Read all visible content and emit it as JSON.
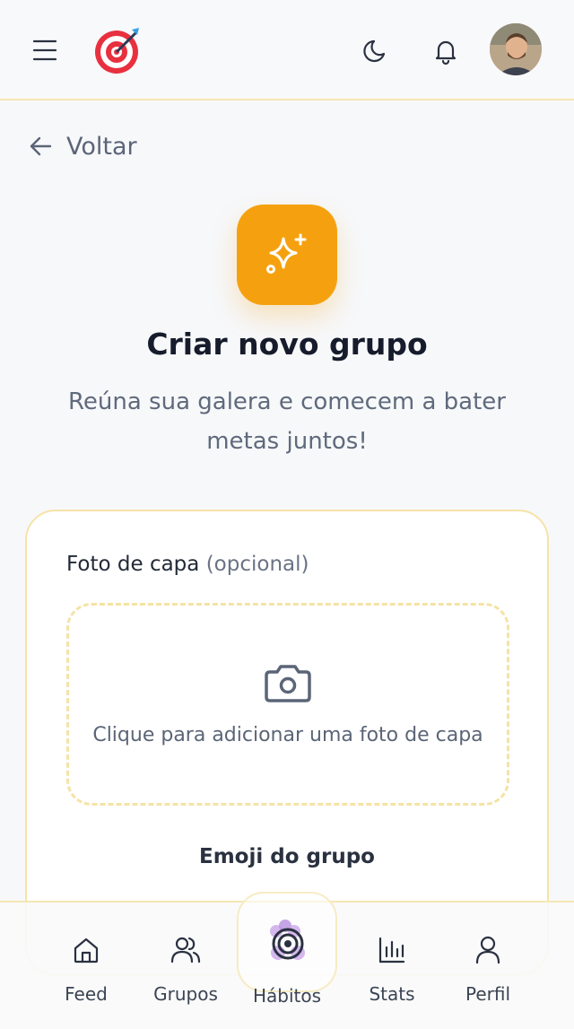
{
  "header": {
    "menu_icon": "hamburger-menu-icon",
    "logo_icon": "target-dart-icon",
    "theme_icon": "moon-icon",
    "notifications_icon": "bell-icon",
    "avatar": "user-avatar"
  },
  "back": {
    "label": "Voltar"
  },
  "hero": {
    "icon": "sparkles-icon",
    "title": "Criar novo grupo",
    "subtitle": "Reúna sua galera e comecem a bater metas juntos!"
  },
  "form": {
    "cover_label": "Foto de capa",
    "cover_optional": "(opcional)",
    "cover_upload_text": "Clique para adicionar uma foto de capa",
    "emoji_label": "Emoji do grupo"
  },
  "nav": {
    "items": [
      {
        "label": "Feed",
        "icon": "home-icon"
      },
      {
        "label": "Grupos",
        "icon": "users-icon"
      },
      {
        "label": "Hábitos",
        "icon": "target-icon"
      },
      {
        "label": "Stats",
        "icon": "bar-chart-icon"
      },
      {
        "label": "Perfil",
        "icon": "user-icon"
      }
    ]
  },
  "colors": {
    "accent": "#f5a10f",
    "border": "#f6e7b3",
    "background": "#f7f8fa"
  }
}
